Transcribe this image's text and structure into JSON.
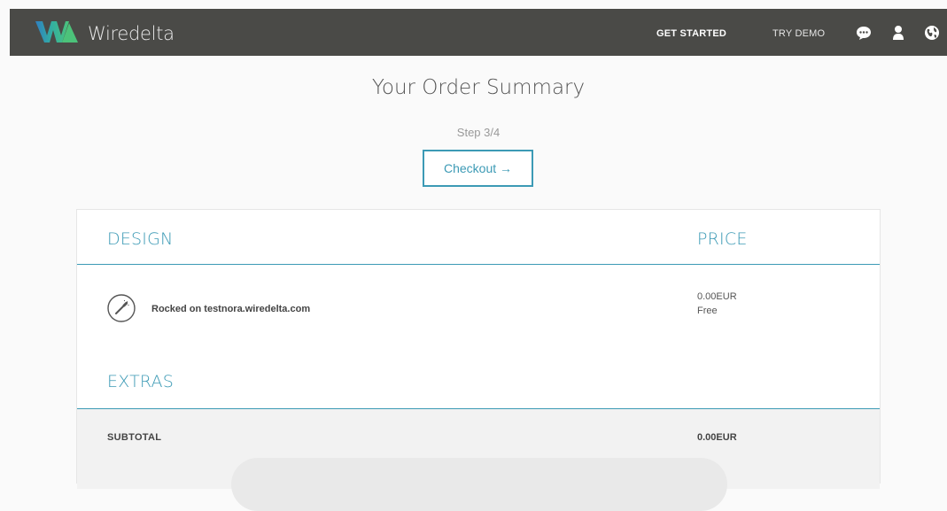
{
  "header": {
    "brand": "Wiredelta",
    "nav": {
      "get_started": "GET STARTED",
      "try_demo": "TRY DEMO"
    },
    "icons": [
      "chat-icon",
      "user-icon",
      "globe-icon"
    ]
  },
  "main": {
    "title": "Your Order Summary",
    "step": "Step 3/4",
    "checkout_label": "Checkout →"
  },
  "summary": {
    "design_heading": "DESIGN",
    "price_heading": "PRICE",
    "item": {
      "label": "Rocked on testnora.wiredelta.com",
      "price": "0.00EUR",
      "note": "Free",
      "icon": "wand-icon"
    },
    "extras_heading": "EXTRAS",
    "subtotal_label": "SUBTOTAL",
    "subtotal_value": "0.00EUR"
  },
  "colors": {
    "accent": "#3c9ab5",
    "topbar": "#4a4a47"
  }
}
